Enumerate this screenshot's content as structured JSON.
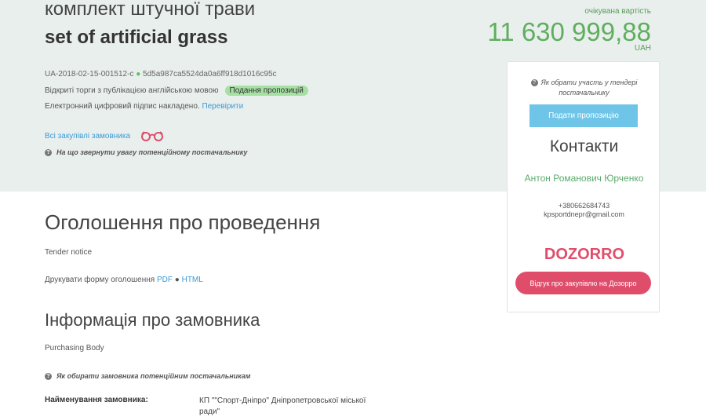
{
  "tender": {
    "title_ua": "комплект штучної трави",
    "title_en": "set of artificial grass",
    "id": "UA-2018-02-15-001512-c",
    "hash": "5d5a987ca5524da0a6ff918d1016c95c",
    "procedure_text": "Відкриті торги з публікацією англійською мовою",
    "status_badge": "Подання пропозицій",
    "signature_text": "Електронний цифровий підпис накладено.",
    "verify_link": "Перевірити",
    "all_purchases_link": "Всі закупівлі замовника",
    "attention_text": "На що звернути увагу потенційному постачальнику"
  },
  "price": {
    "label": "очікувана вартість",
    "value": "11 630 999,88",
    "currency": "UAH"
  },
  "sidebar": {
    "how_to_participate": "Як обрати участь у тендері постачальнику",
    "submit_button": "Подати пропозицію",
    "contacts_title": "Контакти",
    "contact_name": "Антон Романович Юрченко",
    "contact_phone": "+380662684743",
    "contact_email": "kpsportdnepr@gmail.com",
    "logo_text": "DOZORRO",
    "feedback_button": "Відгук про закупівлю на Дозорро"
  },
  "main": {
    "announcement_heading": "Оголошення про проведення",
    "announcement_sub": "Tender notice",
    "print_text": "Друкувати форму оголошення",
    "print_pdf": "PDF",
    "print_html": "HTML",
    "customer_heading": "Інформація про замовника",
    "customer_sub": "Purchasing Body",
    "how_choose_customer": "Як обирати замовника потенційним постачальникам",
    "customer_name_label": "Найменування замовника:",
    "customer_name_value": "КП \"\"Спорт-Дніпро\" Дніпропетровської міської ради\""
  },
  "colors": {
    "hero_bg": "#e9efec",
    "price_green": "#5fae5f",
    "link_blue": "#3a9bd6",
    "submit_blue": "#6fc5e8",
    "feedback_red": "#e04d6b",
    "badge_green": "#a6e0a3"
  }
}
